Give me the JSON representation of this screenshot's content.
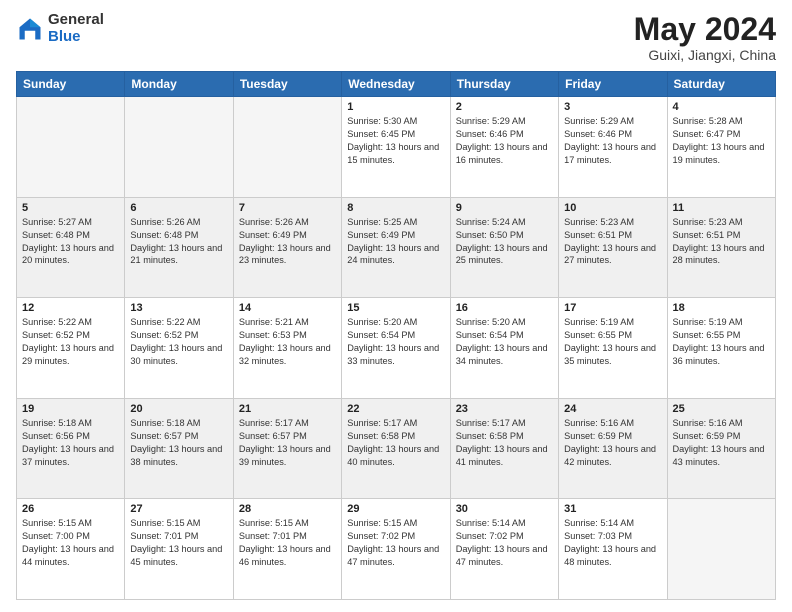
{
  "logo": {
    "general": "General",
    "blue": "Blue"
  },
  "title": "May 2024",
  "subtitle": "Guixi, Jiangxi, China",
  "weekdays": [
    "Sunday",
    "Monday",
    "Tuesday",
    "Wednesday",
    "Thursday",
    "Friday",
    "Saturday"
  ],
  "weeks": [
    [
      {
        "day": "",
        "info": "",
        "empty": true
      },
      {
        "day": "",
        "info": "",
        "empty": true
      },
      {
        "day": "",
        "info": "",
        "empty": true
      },
      {
        "day": "1",
        "info": "Sunrise: 5:30 AM\nSunset: 6:45 PM\nDaylight: 13 hours\nand 15 minutes."
      },
      {
        "day": "2",
        "info": "Sunrise: 5:29 AM\nSunset: 6:46 PM\nDaylight: 13 hours\nand 16 minutes."
      },
      {
        "day": "3",
        "info": "Sunrise: 5:29 AM\nSunset: 6:46 PM\nDaylight: 13 hours\nand 17 minutes."
      },
      {
        "day": "4",
        "info": "Sunrise: 5:28 AM\nSunset: 6:47 PM\nDaylight: 13 hours\nand 19 minutes."
      }
    ],
    [
      {
        "day": "5",
        "info": "Sunrise: 5:27 AM\nSunset: 6:48 PM\nDaylight: 13 hours\nand 20 minutes.",
        "shaded": true
      },
      {
        "day": "6",
        "info": "Sunrise: 5:26 AM\nSunset: 6:48 PM\nDaylight: 13 hours\nand 21 minutes.",
        "shaded": true
      },
      {
        "day": "7",
        "info": "Sunrise: 5:26 AM\nSunset: 6:49 PM\nDaylight: 13 hours\nand 23 minutes.",
        "shaded": true
      },
      {
        "day": "8",
        "info": "Sunrise: 5:25 AM\nSunset: 6:49 PM\nDaylight: 13 hours\nand 24 minutes.",
        "shaded": true
      },
      {
        "day": "9",
        "info": "Sunrise: 5:24 AM\nSunset: 6:50 PM\nDaylight: 13 hours\nand 25 minutes.",
        "shaded": true
      },
      {
        "day": "10",
        "info": "Sunrise: 5:23 AM\nSunset: 6:51 PM\nDaylight: 13 hours\nand 27 minutes.",
        "shaded": true
      },
      {
        "day": "11",
        "info": "Sunrise: 5:23 AM\nSunset: 6:51 PM\nDaylight: 13 hours\nand 28 minutes.",
        "shaded": true
      }
    ],
    [
      {
        "day": "12",
        "info": "Sunrise: 5:22 AM\nSunset: 6:52 PM\nDaylight: 13 hours\nand 29 minutes."
      },
      {
        "day": "13",
        "info": "Sunrise: 5:22 AM\nSunset: 6:52 PM\nDaylight: 13 hours\nand 30 minutes."
      },
      {
        "day": "14",
        "info": "Sunrise: 5:21 AM\nSunset: 6:53 PM\nDaylight: 13 hours\nand 32 minutes."
      },
      {
        "day": "15",
        "info": "Sunrise: 5:20 AM\nSunset: 6:54 PM\nDaylight: 13 hours\nand 33 minutes."
      },
      {
        "day": "16",
        "info": "Sunrise: 5:20 AM\nSunset: 6:54 PM\nDaylight: 13 hours\nand 34 minutes."
      },
      {
        "day": "17",
        "info": "Sunrise: 5:19 AM\nSunset: 6:55 PM\nDaylight: 13 hours\nand 35 minutes."
      },
      {
        "day": "18",
        "info": "Sunrise: 5:19 AM\nSunset: 6:55 PM\nDaylight: 13 hours\nand 36 minutes."
      }
    ],
    [
      {
        "day": "19",
        "info": "Sunrise: 5:18 AM\nSunset: 6:56 PM\nDaylight: 13 hours\nand 37 minutes.",
        "shaded": true
      },
      {
        "day": "20",
        "info": "Sunrise: 5:18 AM\nSunset: 6:57 PM\nDaylight: 13 hours\nand 38 minutes.",
        "shaded": true
      },
      {
        "day": "21",
        "info": "Sunrise: 5:17 AM\nSunset: 6:57 PM\nDaylight: 13 hours\nand 39 minutes.",
        "shaded": true
      },
      {
        "day": "22",
        "info": "Sunrise: 5:17 AM\nSunset: 6:58 PM\nDaylight: 13 hours\nand 40 minutes.",
        "shaded": true
      },
      {
        "day": "23",
        "info": "Sunrise: 5:17 AM\nSunset: 6:58 PM\nDaylight: 13 hours\nand 41 minutes.",
        "shaded": true
      },
      {
        "day": "24",
        "info": "Sunrise: 5:16 AM\nSunset: 6:59 PM\nDaylight: 13 hours\nand 42 minutes.",
        "shaded": true
      },
      {
        "day": "25",
        "info": "Sunrise: 5:16 AM\nSunset: 6:59 PM\nDaylight: 13 hours\nand 43 minutes.",
        "shaded": true
      }
    ],
    [
      {
        "day": "26",
        "info": "Sunrise: 5:15 AM\nSunset: 7:00 PM\nDaylight: 13 hours\nand 44 minutes."
      },
      {
        "day": "27",
        "info": "Sunrise: 5:15 AM\nSunset: 7:01 PM\nDaylight: 13 hours\nand 45 minutes."
      },
      {
        "day": "28",
        "info": "Sunrise: 5:15 AM\nSunset: 7:01 PM\nDaylight: 13 hours\nand 46 minutes."
      },
      {
        "day": "29",
        "info": "Sunrise: 5:15 AM\nSunset: 7:02 PM\nDaylight: 13 hours\nand 47 minutes."
      },
      {
        "day": "30",
        "info": "Sunrise: 5:14 AM\nSunset: 7:02 PM\nDaylight: 13 hours\nand 47 minutes."
      },
      {
        "day": "31",
        "info": "Sunrise: 5:14 AM\nSunset: 7:03 PM\nDaylight: 13 hours\nand 48 minutes."
      },
      {
        "day": "",
        "info": "",
        "empty": true
      }
    ]
  ]
}
